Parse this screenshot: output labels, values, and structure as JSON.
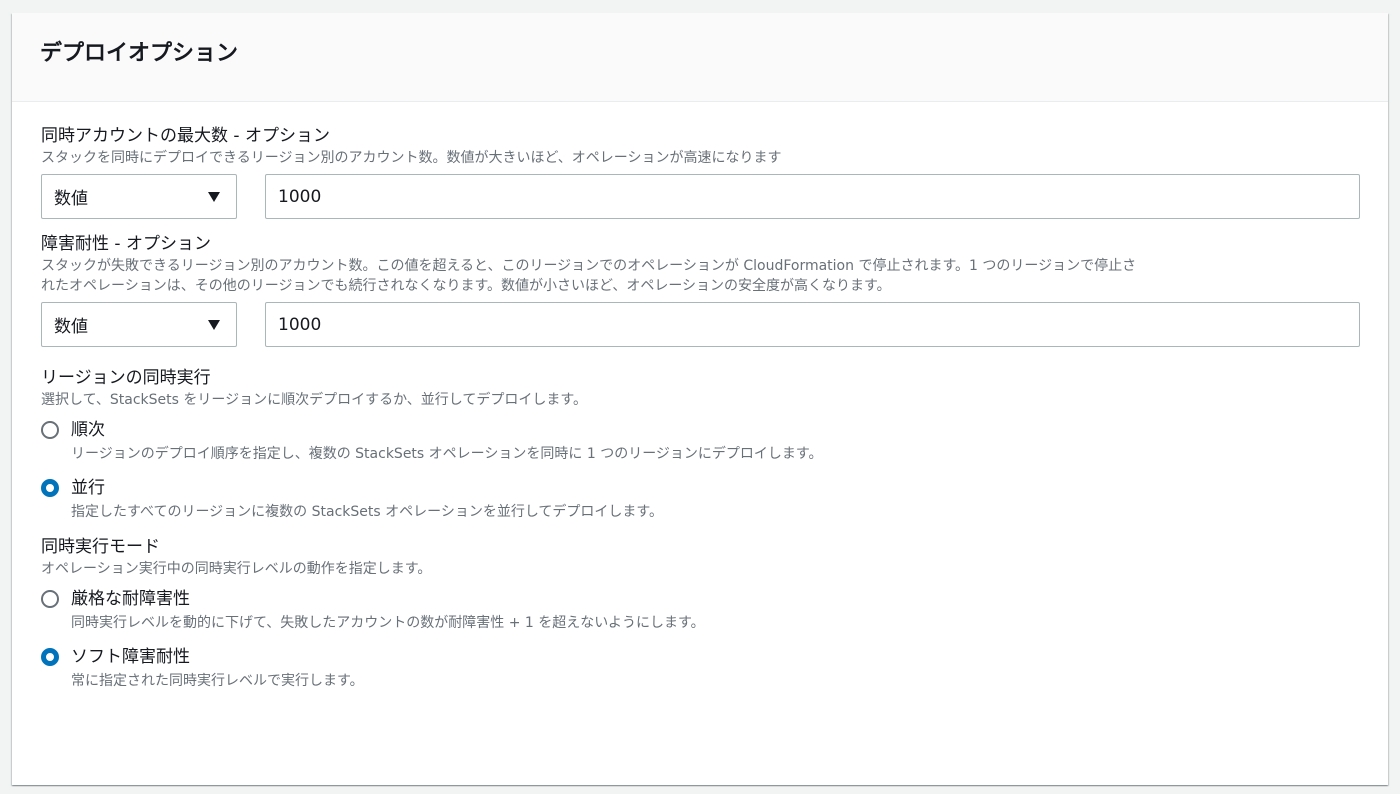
{
  "panel": {
    "title": "デプロイオプション"
  },
  "max_concurrent": {
    "label": "同時アカウントの最大数 - オプション",
    "description": "スタックを同時にデプロイできるリージョン別のアカウント数。数値が大きいほど、オペレーションが高速になります",
    "select_value": "数値",
    "input_value": "1000"
  },
  "failure_tolerance": {
    "label": "障害耐性 - オプション",
    "description_line1": "スタックが失敗できるリージョン別のアカウント数。この値を超えると、このリージョンでのオペレーションが CloudFormation で停止されます。1 つのリージョンで停止さ",
    "description_line2": "れたオペレーションは、その他のリージョンでも続行されなくなります。数値が小さいほど、オペレーションの安全度が高くなります。",
    "select_value": "数値",
    "input_value": "1000"
  },
  "region_concurrency": {
    "label": "リージョンの同時実行",
    "description": "選択して、StackSets をリージョンに順次デプロイするか、並行してデプロイします。",
    "options": [
      {
        "label": "順次",
        "description": "リージョンのデプロイ順序を指定し、複数の StackSets オペレーションを同時に 1 つのリージョンにデプロイします。",
        "checked": false
      },
      {
        "label": "並行",
        "description": "指定したすべてのリージョンに複数の StackSets オペレーションを並行してデプロイします。",
        "checked": true
      }
    ]
  },
  "concurrency_mode": {
    "label": "同時実行モード",
    "description": "オペレーション実行中の同時実行レベルの動作を指定します。",
    "options": [
      {
        "label": "厳格な耐障害性",
        "description": "同時実行レベルを動的に下げて、失敗したアカウントの数が耐障害性 + 1 を超えないようにします。",
        "checked": false
      },
      {
        "label": "ソフト障害耐性",
        "description": "常に指定された同時実行レベルで実行します。",
        "checked": true
      }
    ]
  },
  "colors": {
    "accent": "#0073bb",
    "secondary_text": "#687078",
    "border": "#aab7b8"
  }
}
